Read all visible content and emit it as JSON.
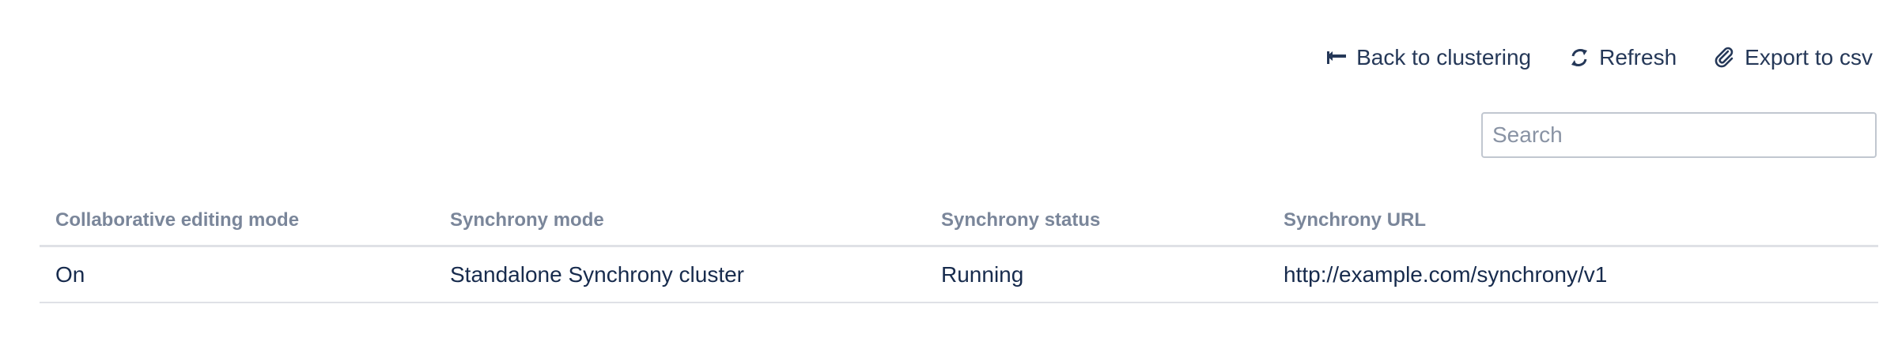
{
  "toolbar": {
    "back_label": "Back to clustering",
    "back_icon": "back-arrow-icon",
    "refresh_label": "Refresh",
    "refresh_icon": "refresh-icon",
    "export_label": "Export to csv",
    "export_icon": "paperclip-icon"
  },
  "search": {
    "placeholder": "Search",
    "value": ""
  },
  "table": {
    "headers": [
      "Collaborative editing mode",
      "Synchrony mode",
      "Synchrony status",
      "Synchrony URL"
    ],
    "rows": [
      [
        "On",
        "Standalone Synchrony cluster",
        "Running",
        "http://example.com/synchrony/v1"
      ]
    ]
  },
  "colors": {
    "text": "#172b4d",
    "header_text": "#7a869a",
    "border": "#dfe1e6"
  }
}
